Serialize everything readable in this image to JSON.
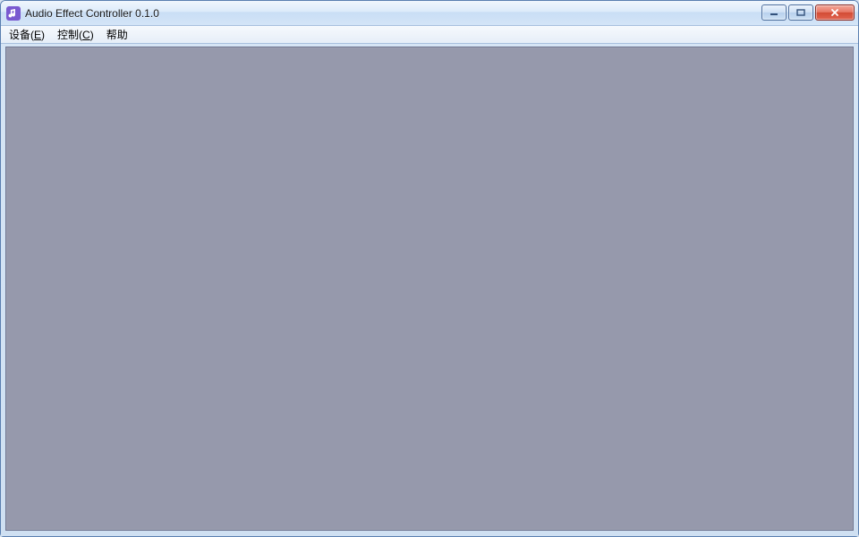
{
  "window": {
    "title": "Audio Effect Controller 0.1.0",
    "icon_name": "app-note-icon"
  },
  "menubar": {
    "items": [
      {
        "label": "设备",
        "mnemonic": "E"
      },
      {
        "label": "控制",
        "mnemonic": "C"
      },
      {
        "label": "帮助",
        "mnemonic": ""
      }
    ]
  },
  "window_controls": {
    "minimize": "minimize",
    "maximize": "maximize",
    "close": "close"
  },
  "colors": {
    "frame_top": "#e8f1fb",
    "frame_bottom": "#cfe0f2",
    "content_bg": "#9699ac",
    "close_bg": "#d24b34"
  }
}
